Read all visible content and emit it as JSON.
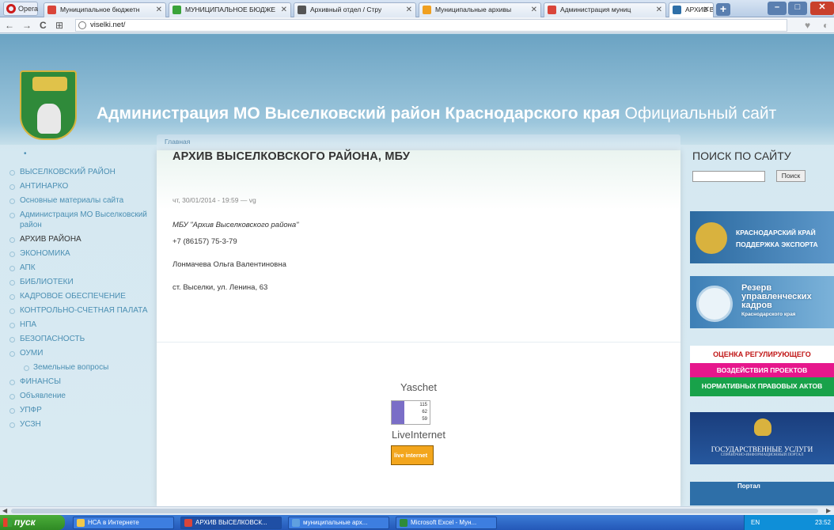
{
  "browser": {
    "menu_label": "Opera",
    "tabs": [
      {
        "title": "Муниципальное бюджетн",
        "active": false
      },
      {
        "title": "МУНИЦИПАЛЬНОЕ БЮДЖЕ",
        "active": false
      },
      {
        "title": "Архивный отдел / Стру",
        "active": false
      },
      {
        "title": "Муниципальные архивы",
        "active": false
      },
      {
        "title": "Администрация муниц",
        "active": false
      },
      {
        "title": "АРХИВ ВЫСЕЛКОВСКОГО",
        "active": true
      }
    ],
    "new_tab": "+",
    "url": "viselki.net/"
  },
  "header": {
    "title_bold": "Администрация МО Выселковский район Краснодарского края",
    "title_rest": " Официальный сайт",
    "breadcrumb": "Главная"
  },
  "sidebar": {
    "top_dot": "•",
    "items": [
      {
        "label": "ВЫСЕЛКОВСКИЙ РАЙОН"
      },
      {
        "label": "АНТИНАРКО"
      },
      {
        "label": "Основные материалы сайта"
      },
      {
        "label": "Администрация МО Выселковский район"
      },
      {
        "label": "АРХИВ РАЙОНА"
      },
      {
        "label": "ЭКОНОМИКА"
      },
      {
        "label": "АПК"
      },
      {
        "label": "БИБЛИОТЕКИ"
      },
      {
        "label": "КАДРОВОЕ ОБЕСПЕЧЕНИЕ"
      },
      {
        "label": "КОНТРОЛЬНО-СЧЕТНАЯ ПАЛАТА"
      },
      {
        "label": "НПА"
      },
      {
        "label": "БЕЗОПАСНОСТЬ"
      },
      {
        "label": "ОУМИ"
      },
      {
        "label": "Земельные вопросы"
      },
      {
        "label": "ФИНАНСЫ"
      },
      {
        "label": "Объявление"
      },
      {
        "label": "УПФР"
      },
      {
        "label": "УСЗН"
      }
    ]
  },
  "article": {
    "title": "АРХИВ ВЫСЕЛКОВСКОГО РАЙОНА, МБУ",
    "meta": "чт, 30/01/2014 - 19:59 — vg",
    "org": "МБУ \"Архив Выселковского района\"",
    "phone": "+7 (86157) 75-3-79",
    "person": "Лонмачева Ольга Валентиновна",
    "address": "ст. Выселки, ул. Ленина, 63"
  },
  "counters": {
    "yaschet_label": "Yaschet",
    "yaschet_values": [
      "115",
      "62",
      "59"
    ],
    "liveinternet_label": "LiveInternet",
    "liveinternet_badge": "live internet"
  },
  "search": {
    "title": "ПОИСК ПО САЙТУ",
    "button": "Поиск",
    "value": ""
  },
  "banners": {
    "b1": [
      "КРАСНОДАРСКИЙ КРАЙ",
      "ПОДДЕРЖКА ЭКСПОРТА"
    ],
    "b2": [
      "Резерв",
      "управленческих",
      "кадров",
      "Краснодарского края"
    ],
    "b3": [
      "ОЦЕНКА РЕГУЛИРУЮЩЕГО",
      "ВОЗДЕЙСТВИЯ ПРОЕКТОВ",
      "НОРМАТИВНЫХ ПРАВОВЫХ АКТОВ"
    ],
    "b4": [
      "ГОСУДАРСТВЕННЫЕ УСЛУГИ",
      "СПРАВОЧНО-ИНФОРМАЦИОННЫЙ ПОРТАЛ"
    ],
    "b5": "Портал"
  },
  "taskbar": {
    "start": "пуск",
    "tasks": [
      {
        "label": "НСА в Интернете"
      },
      {
        "label": "АРХИВ ВЫСЕЛКОВСК..."
      },
      {
        "label": "муниципальные арх..."
      },
      {
        "label": "Microsoft Excel - Мун..."
      }
    ],
    "tray_lang": "EN",
    "clock": "23:52"
  }
}
